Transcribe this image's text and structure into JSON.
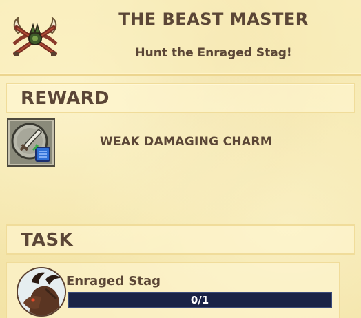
{
  "quest": {
    "title": "THE BEAST MASTER",
    "subtitle": "Hunt the Enraged Stag!",
    "icon": "crossed-bows-horns-emblem-icon"
  },
  "reward": {
    "header": "REWARD",
    "item_name": "WEAK DAMAGING CHARM",
    "item_icon": "sword-charm-icon"
  },
  "task": {
    "header": "TASK",
    "target_name": "Enraged Stag",
    "target_icon": "stag-portrait-icon",
    "progress_text": "0/1",
    "progress_current": 0,
    "progress_total": 1
  },
  "colors": {
    "parchment": "#f6e9b2",
    "text": "#5b4636",
    "progress_bg": "#1a2346"
  }
}
